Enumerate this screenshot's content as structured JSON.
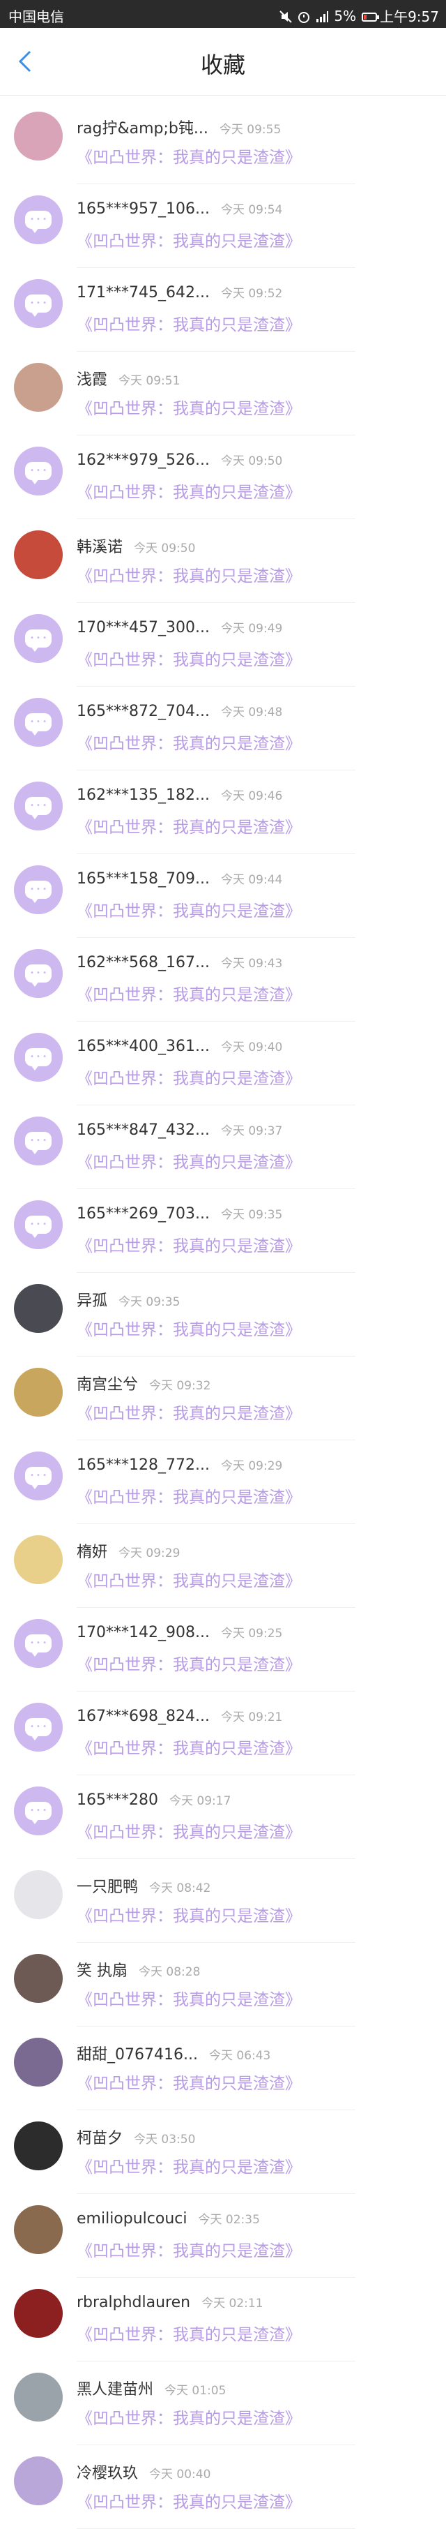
{
  "status": {
    "carrier": "中国电信",
    "battery": "5%",
    "clock": "上午9:57"
  },
  "header": {
    "title": "收藏"
  },
  "items": [
    {
      "name": "rag拧&amp;b钝...",
      "time": "今天 09:55",
      "sub": "《凹凸世界：我真的只是渣渣》",
      "avatar": "photo-pink"
    },
    {
      "name": "165***957_106...",
      "time": "今天 09:54",
      "sub": "《凹凸世界：我真的只是渣渣》",
      "avatar": "message"
    },
    {
      "name": "171***745_642...",
      "time": "今天 09:52",
      "sub": "《凹凸世界：我真的只是渣渣》",
      "avatar": "message"
    },
    {
      "name": "浅霞",
      "time": "今天 09:51",
      "sub": "《凹凸世界：我真的只是渣渣》",
      "avatar": "photo-anime"
    },
    {
      "name": "162***979_526...",
      "time": "今天 09:50",
      "sub": "《凹凸世界：我真的只是渣渣》",
      "avatar": "message"
    },
    {
      "name": "韩溪诺",
      "time": "今天 09:50",
      "sub": "《凹凸世界：我真的只是渣渣》",
      "avatar": "photo-red"
    },
    {
      "name": "170***457_300...",
      "time": "今天 09:49",
      "sub": "《凹凸世界：我真的只是渣渣》",
      "avatar": "message"
    },
    {
      "name": "165***872_704...",
      "time": "今天 09:48",
      "sub": "《凹凸世界：我真的只是渣渣》",
      "avatar": "message"
    },
    {
      "name": "162***135_182...",
      "time": "今天 09:46",
      "sub": "《凹凸世界：我真的只是渣渣》",
      "avatar": "message"
    },
    {
      "name": "165***158_709...",
      "time": "今天 09:44",
      "sub": "《凹凸世界：我真的只是渣渣》",
      "avatar": "message"
    },
    {
      "name": "162***568_167...",
      "time": "今天 09:43",
      "sub": "《凹凸世界：我真的只是渣渣》",
      "avatar": "message"
    },
    {
      "name": "165***400_361...",
      "time": "今天 09:40",
      "sub": "《凹凸世界：我真的只是渣渣》",
      "avatar": "message"
    },
    {
      "name": "165***847_432...",
      "time": "今天 09:37",
      "sub": "《凹凸世界：我真的只是渣渣》",
      "avatar": "message"
    },
    {
      "name": "165***269_703...",
      "time": "今天 09:35",
      "sub": "《凹凸世界：我真的只是渣渣》",
      "avatar": "message"
    },
    {
      "name": "异孤",
      "time": "今天 09:35",
      "sub": "《凹凸世界：我真的只是渣渣》",
      "avatar": "photo-dark"
    },
    {
      "name": "南宫尘兮",
      "time": "今天 09:32",
      "sub": "《凹凸世界：我真的只是渣渣》",
      "avatar": "photo-dog"
    },
    {
      "name": "165***128_772...",
      "time": "今天 09:29",
      "sub": "《凹凸世界：我真的只是渣渣》",
      "avatar": "message"
    },
    {
      "name": "楕妍",
      "time": "今天 09:29",
      "sub": "《凹凸世界：我真的只是渣渣》",
      "avatar": "photo-yellow"
    },
    {
      "name": "170***142_908...",
      "time": "今天 09:25",
      "sub": "《凹凸世界：我真的只是渣渣》",
      "avatar": "message"
    },
    {
      "name": "167***698_824...",
      "time": "今天 09:21",
      "sub": "《凹凸世界：我真的只是渣渣》",
      "avatar": "message"
    },
    {
      "name": "165***280",
      "time": "今天 09:17",
      "sub": "《凹凸世界：我真的只是渣渣》",
      "avatar": "message"
    },
    {
      "name": "一只肥鸭",
      "time": "今天 08:42",
      "sub": "《凹凸世界：我真的只是渣渣》",
      "avatar": "photo-duck"
    },
    {
      "name": "笑 执扇",
      "time": "今天 08:28",
      "sub": "《凹凸世界：我真的只是渣渣》",
      "avatar": "photo-girl"
    },
    {
      "name": "甜甜_0767416...",
      "time": "今天 06:43",
      "sub": "《凹凸世界：我真的只是渣渣》",
      "avatar": "photo-purple"
    },
    {
      "name": "柯苗夕",
      "time": "今天 03:50",
      "sub": "《凹凸世界：我真的只是渣渣》",
      "avatar": "photo-black"
    },
    {
      "name": "emiliopulcouci",
      "time": "今天 02:35",
      "sub": "《凹凸世界：我真的只是渣渣》",
      "avatar": "photo-brown"
    },
    {
      "name": "rbralphdlauren",
      "time": "今天 02:11",
      "sub": "《凹凸世界：我真的只是渣渣》",
      "avatar": "photo-redblack"
    },
    {
      "name": "黑人建苗州",
      "time": "今天 01:05",
      "sub": "《凹凸世界：我真的只是渣渣》",
      "avatar": "photo-gray"
    },
    {
      "name": "冷樱玖玖",
      "time": "今天 00:40",
      "sub": "《凹凸世界：我真的只是渣渣》",
      "avatar": "photo-lilac"
    }
  ]
}
